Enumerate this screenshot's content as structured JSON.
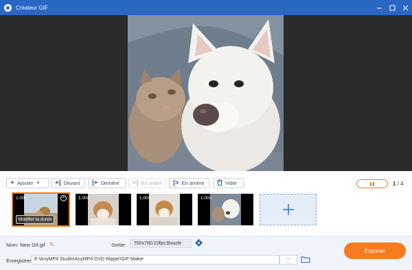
{
  "window": {
    "title": "Créateur GIF"
  },
  "toolbar": {
    "add_label": "Ajouter",
    "front_label": "Devant",
    "behind_label": "Derrière",
    "forward_label": "En avant",
    "backward_label": "En arrière",
    "empty_label": "Vider"
  },
  "playback": {
    "current": "1",
    "separator": "/",
    "total": "4"
  },
  "frames": [
    {
      "duration": "1.00s",
      "edit_label": "Modifier la durée",
      "selected": true
    },
    {
      "duration": "1.00s",
      "selected": false
    },
    {
      "duration": "1.00s",
      "selected": false
    },
    {
      "duration": "1.00s",
      "selected": false
    }
  ],
  "add_frame_icon": "plus-icon",
  "settings": {
    "name_label": "Nom:",
    "name_value": "New Gif.gif",
    "output_label": "Sortie:",
    "output_value": "760x760;10fps;Boucle",
    "save_label": "Enregistrer:",
    "save_path": "E:\\AnyMP4 Studio\\AnyMP4 DVD Ripper\\GIF Maker",
    "browse_label": "···",
    "export_label": "Exporter"
  },
  "colors": {
    "titlebar": "#2a66c4",
    "accent": "#f67b1e",
    "preview_bg": "#2b2b2b"
  }
}
